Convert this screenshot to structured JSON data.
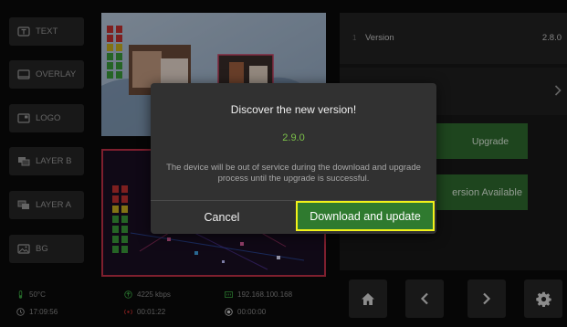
{
  "sidebar": {
    "items": [
      {
        "label": "TEXT",
        "icon": "text-icon"
      },
      {
        "label": "OVERLAY",
        "icon": "overlay-icon"
      },
      {
        "label": "LOGO",
        "icon": "logo-icon"
      },
      {
        "label": "LAYER B",
        "icon": "layer-b-icon"
      },
      {
        "label": "LAYER A",
        "icon": "layer-a-icon"
      },
      {
        "label": "BG",
        "icon": "image-icon"
      }
    ]
  },
  "settings": {
    "version_index": "1",
    "version_label": "Version",
    "version_value": "2.8.0",
    "upgrade_label": "Upgrade",
    "version_available_label": "ersion Available"
  },
  "status": {
    "temperature": "50°C",
    "clock": "17:09:56",
    "bitrate": "4225 kbps",
    "live_timer": "00:01:22",
    "ip_address": "192.168.100.168",
    "record_timer": "00:00:00"
  },
  "nav": {
    "home_icon": "home-icon",
    "prev_icon": "chevron-left-icon",
    "next_icon": "chevron-right-icon",
    "settings_icon": "gear-icon"
  },
  "dialog": {
    "title": "Discover the new version!",
    "new_version": "2.9.0",
    "message": "The device will be out of service during the download and upgrade process until the upgrade is successful.",
    "cancel_label": "Cancel",
    "confirm_label": "Download and update"
  },
  "colors": {
    "accent_green": "#2f7a2f",
    "version_green": "#7cc14a",
    "highlight_yellow": "#f2f21a",
    "live_red": "#d03030"
  }
}
